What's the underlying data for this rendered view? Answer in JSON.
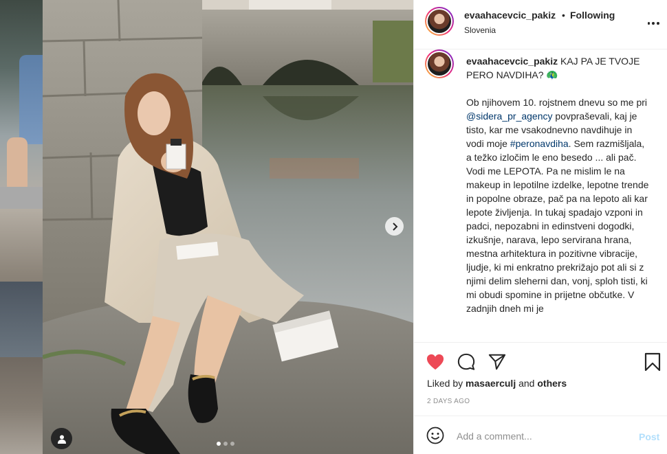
{
  "post": {
    "username": "evaahacevcic_pakiz",
    "separator": "•",
    "follow_status": "Following",
    "location": "Slovenia",
    "more_icon": "more-options-icon"
  },
  "caption": {
    "username": "evaahacevcic_pakiz",
    "headline": " KAJ PA JE TVOJE PERO NAVDIHA? 🦚",
    "p1_a": "Ob njihovem 10. rojstnem dnevu so me pri ",
    "mention": "@sidera_pr_agency",
    "p1_b": " povpraševali, kaj je tisto, kar me vsakodnevno navdihuje in vodi moje ",
    "hashtag": "#peronavdiha",
    "p1_c": ". Sem razmišljala, a težko izločim le eno besedo ... ali pač. Vodi me LEPOTA. Pa ne mislim le na makeup in lepotilne izdelke, lepotne trende in popolne obraze, pač pa na lepoto ali kar lepote življenja. In tukaj spadajo vzponi in padci, nepozabni in edinstveni dogodki, izkušnje, narava, lepo servirana hrana, mestna arhitektura in pozitivne vibracije, ljudje, ki mi enkratno prekrižajo pot ali si z njimi delim sleherni dan, vonj, sploh tisti, ki mi obudi spomine in prijetne občutke. V zadnjih dneh mi je"
  },
  "likes": {
    "prefix": "Liked by ",
    "user": "masaerculj",
    "and": " and ",
    "others": "others"
  },
  "timestamp": "2 DAYS AGO",
  "comment": {
    "placeholder": "Add a comment...",
    "post_label": "Post"
  },
  "carousel": {
    "slide_count": 3,
    "active_slide": 1
  },
  "colors": {
    "like_red": "#ed4956",
    "link_blue": "#00376b",
    "post_disabled": "#b2dffc",
    "muted": "#8e8e8e"
  }
}
